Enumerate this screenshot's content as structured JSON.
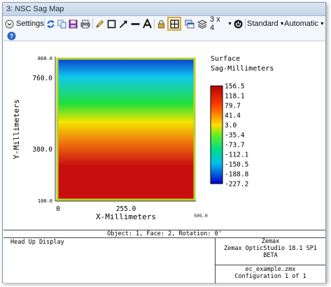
{
  "window": {
    "title": "3: NSC Sag Map"
  },
  "toolbar": {
    "settings_label": "Settings",
    "layout_label": "3 x 4",
    "standard_label": "Standard",
    "automatic_label": "Automatic"
  },
  "chart_data": {
    "type": "heatmap",
    "xlabel": "X-Millimeters",
    "ylabel": "Y-Millimeters",
    "xticks": [
      "0",
      "255.0",
      "505.0"
    ],
    "yticks": [
      "860.0",
      "760.0",
      "380.0",
      "100.0"
    ],
    "legend_title": [
      "Surface",
      "Sag-Millimeters"
    ],
    "colorbar_labels": [
      "156.5",
      "118.1",
      "79.7",
      "41.4",
      "3.0",
      "-35.4",
      "-73.7",
      "-112.1",
      "-150.5",
      "-188.8",
      "-227.2"
    ],
    "colorbar_min": -227.2,
    "colorbar_max": 156.5
  },
  "info": {
    "header": "Object: 1, Face: 2, Rotation: 0'",
    "left": "Head Up Display",
    "right_title": "Zemax",
    "right_product": "Zemax OpticStudio 18.1 SP1 BETA",
    "file": "ec_example.zmx",
    "config": "Configuration 1 of 1"
  },
  "colors": {
    "accent": "#2a62c9",
    "surface_gradient": [
      "#0a3ed0",
      "#0fc8ee",
      "#22e03a",
      "#f4e400",
      "#f07010",
      "#c80e0e"
    ]
  }
}
